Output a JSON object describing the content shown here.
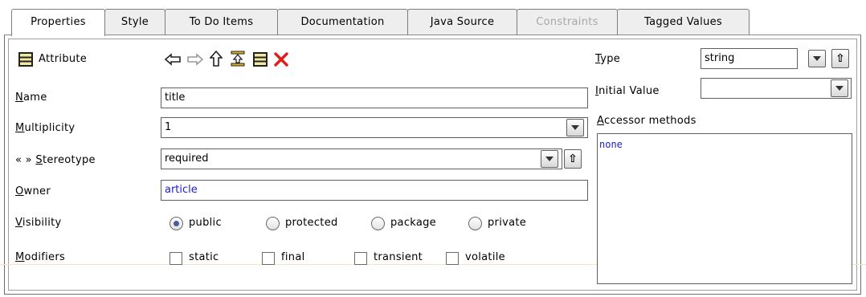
{
  "tabs": [
    {
      "label": "Properties",
      "active": true
    },
    {
      "label": "Style"
    },
    {
      "label": "To Do Items"
    },
    {
      "label": "Documentation"
    },
    {
      "label": "Java Source"
    },
    {
      "label": "Constraints",
      "disabled": true
    },
    {
      "label": "Tagged Values"
    }
  ],
  "header": {
    "title": "Attribute",
    "title_icon": "attribute-icon"
  },
  "toolbar": [
    "navigate-back-icon",
    "navigate-forward-icon",
    "navigate-up-icon",
    "new-stereotype-icon",
    "new-attribute-icon",
    "delete-icon"
  ],
  "fields": {
    "name": {
      "label": "Name",
      "value": "title"
    },
    "multiplicity": {
      "label": "Multiplicity",
      "value": "1"
    },
    "stereotype": {
      "label_prefix": "« »",
      "label": "Stereotype",
      "value": "required"
    },
    "owner": {
      "label": "Owner",
      "value": "article"
    }
  },
  "visibility": {
    "label": "Visibility",
    "options": [
      "public",
      "protected",
      "package",
      "private"
    ],
    "selected": "public"
  },
  "modifiers": {
    "label": "Modifiers",
    "options": [
      "static",
      "final",
      "transient",
      "volatile"
    ],
    "checked": []
  },
  "right": {
    "type": {
      "label": "Type",
      "value": "string"
    },
    "initial_value": {
      "label": "Initial Value",
      "value": ""
    },
    "accessor": {
      "label": "Accessor methods",
      "value": "none"
    }
  }
}
